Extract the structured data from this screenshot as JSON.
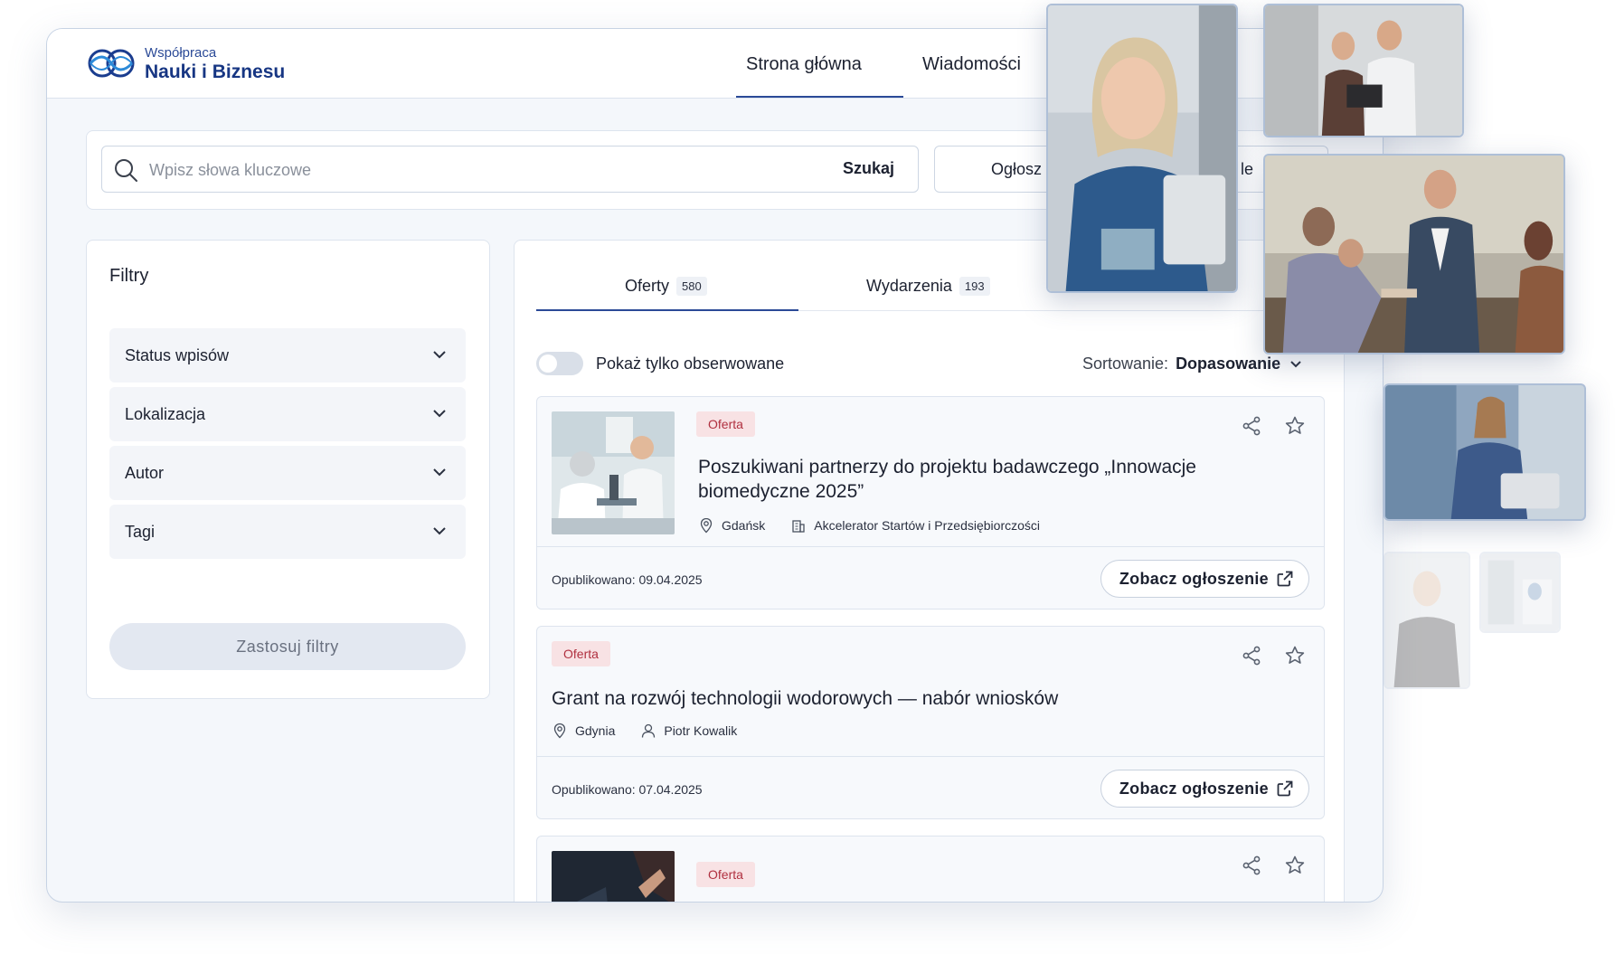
{
  "brand": {
    "line1": "Współpraca",
    "line2": "Nauki i Biznesu"
  },
  "nav": {
    "home": "Strona główna",
    "news": "Wiadomości"
  },
  "search": {
    "placeholder": "Wpisz słowa kluczowe",
    "button": "Szukaj",
    "post_button": "Ogłosz",
    "post_button_tail": "le"
  },
  "filters": {
    "title": "Filtry",
    "items": [
      {
        "label": "Status wpisów"
      },
      {
        "label": "Lokalizacja"
      },
      {
        "label": "Autor"
      },
      {
        "label": "Tagi"
      }
    ],
    "apply": "Zastosuj filtry"
  },
  "tabs": [
    {
      "label": "Oferty",
      "count": "580",
      "active": true
    },
    {
      "label": "Wydarzenia",
      "count": "193",
      "active": false
    }
  ],
  "toggle": {
    "label": "Pokaż tylko obserwowane",
    "on": false
  },
  "sort": {
    "label": "Sortowanie:",
    "value": "Dopasowanie"
  },
  "cards": [
    {
      "badge": "Oferta",
      "title_line1": "Poszukiwani partnerzy do projektu badawczego „Innowacje",
      "title_line2": "biomedyczne 2025”",
      "location": "Gdańsk",
      "organization": "Akcelerator Startów i Przedsiębiorczości",
      "published_label": "Opublikowano:",
      "published_date": "09.04.2025",
      "button": "Zobacz ogłoszenie"
    },
    {
      "badge": "Oferta",
      "title_line1": "Grant na rozwój technologii wodorowych — nabór wniosków",
      "location": "Gdynia",
      "author": "Piotr Kowalik",
      "published_label": "Opublikowano:",
      "published_date": "07.04.2025",
      "button": "Zobacz ogłoszenie"
    },
    {
      "badge": "Oferta"
    }
  ],
  "colors": {
    "accent": "#2b4a97",
    "badge_bg": "#f8e2e4",
    "badge_text": "#b0303f",
    "page_bg": "#f4f7fb"
  },
  "icons": [
    "logo-mark",
    "search-icon",
    "chevron-down-icon",
    "share-icon",
    "star-icon",
    "location-pin-icon",
    "building-icon",
    "user-icon",
    "external-link-icon"
  ]
}
